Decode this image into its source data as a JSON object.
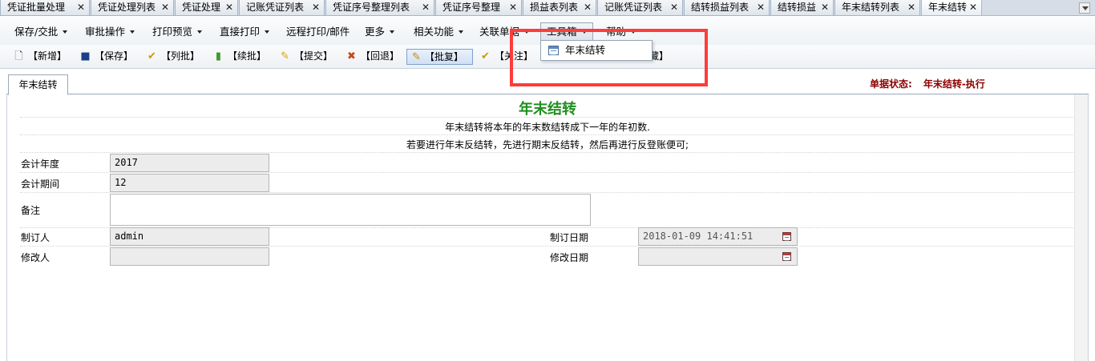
{
  "tabs": [
    {
      "label": "凭证批量处理",
      "close": "✕"
    },
    {
      "label": "凭证处理列表",
      "close": "✕"
    },
    {
      "label": "凭证处理",
      "close": "✕"
    },
    {
      "label": "记账凭证列表",
      "close": "✕"
    },
    {
      "label": "凭证序号整理列表",
      "close": "✕"
    },
    {
      "label": "凭证序号整理",
      "close": "✕"
    },
    {
      "label": "损益表列表",
      "close": "✕"
    },
    {
      "label": "记账凭证列表",
      "close": "✕"
    },
    {
      "label": "结转损益列表",
      "close": "✕"
    },
    {
      "label": "结转损益",
      "close": "✕"
    },
    {
      "label": "年末结转列表",
      "close": "✕"
    },
    {
      "label": "年末结转",
      "close": "✕",
      "active": true
    }
  ],
  "menubar": [
    {
      "label": "保存/交批"
    },
    {
      "label": "审批操作"
    },
    {
      "label": "打印预览"
    },
    {
      "label": "直接打印"
    },
    {
      "label": "远程打印/邮件"
    },
    {
      "label": "更多"
    },
    {
      "label": "相关功能"
    },
    {
      "label": "关联单据"
    },
    {
      "label": "工具箱",
      "open": true
    },
    {
      "label": "帮助"
    }
  ],
  "toolbar": [
    {
      "label": "【新增】",
      "icon": "new-doc-icon"
    },
    {
      "label": "【保存】",
      "icon": "floppy-icon"
    },
    {
      "label": "【列批】",
      "icon": "check-list-icon"
    },
    {
      "label": "【续批】",
      "icon": "stack-icon"
    },
    {
      "label": "【提交】",
      "icon": "submit-icon"
    },
    {
      "label": "【回退】",
      "icon": "cross-icon"
    },
    {
      "label": "【批复】",
      "icon": "pencil-icon",
      "pressed": true
    },
    {
      "label": "【关注】",
      "icon": "check-icon"
    },
    {
      "label": "藏】",
      "icon": ""
    }
  ],
  "dropdown": {
    "items": [
      {
        "label": "年末结转",
        "icon": "table-icon"
      }
    ]
  },
  "panel": {
    "tab": "年末结转"
  },
  "status": {
    "label": "单据状态:",
    "value": "年末结转-执行"
  },
  "form": {
    "title": "年末结转",
    "desc1": "年末结转将本年的年末数结转成下一年的年初数.",
    "desc2": "若要进行年末反结转，先进行期末反结转，然后再进行反登账便可;",
    "fields": {
      "year": {
        "label": "会计年度",
        "value": "2017"
      },
      "period": {
        "label": "会计期间",
        "value": "12"
      },
      "remark": {
        "label": "备注",
        "value": ""
      },
      "creator": {
        "label": "制订人",
        "value": "admin"
      },
      "modifier": {
        "label": "修改人",
        "value": ""
      },
      "created_date": {
        "label": "制订日期",
        "value": "2018-01-09 14:41:51"
      },
      "modified_date": {
        "label": "修改日期",
        "value": ""
      }
    }
  }
}
